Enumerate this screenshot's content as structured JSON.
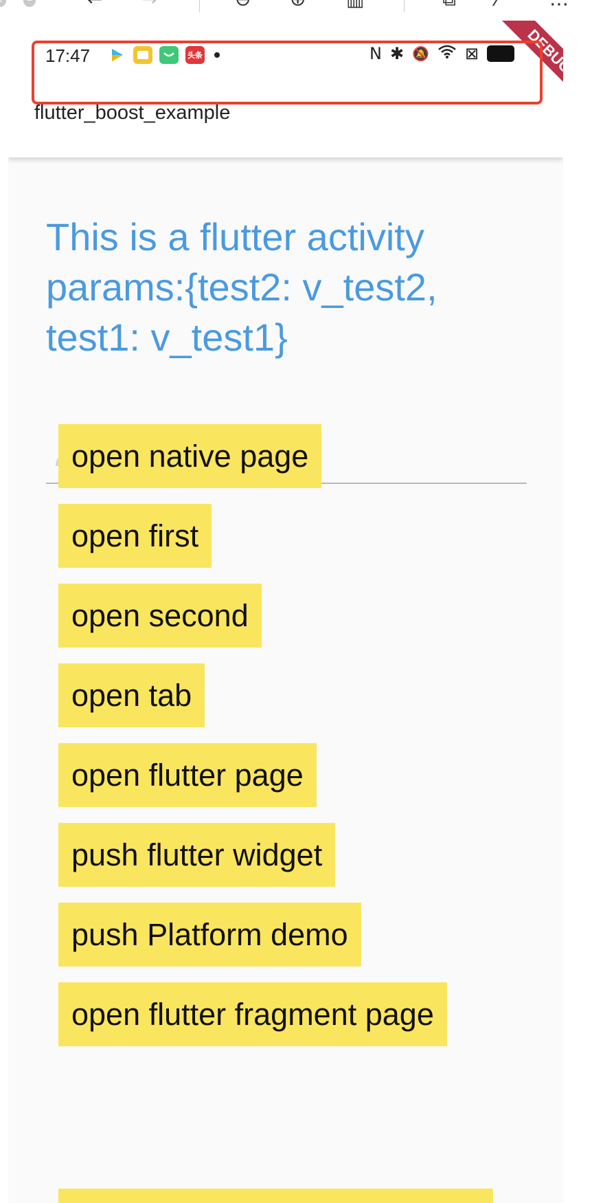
{
  "viewer_toolbar": {
    "icons": [
      "close-icon",
      "back-icon",
      "forward-icon",
      "zoom-out-icon",
      "zoom-in-icon",
      "fit-page-icon",
      "rotate-icon",
      "magic-wand-icon",
      "more-icon"
    ]
  },
  "status_bar": {
    "time": "17:47",
    "apps": [
      {
        "icon": "video-app-icon",
        "color": "#37b6ea"
      },
      {
        "icon": "notes-app-icon",
        "color": "#f4c430"
      },
      {
        "icon": "wechat-store-icon",
        "color": "#3fc77a",
        "text": ""
      },
      {
        "icon": "toutiao-app-icon",
        "color": "#e0373a",
        "text": "头条"
      }
    ],
    "right_icons": [
      "nfc-icon",
      "bluetooth-icon",
      "mute-icon",
      "wifi-icon",
      "sim-icon",
      "battery-icon"
    ],
    "right_glyphs": [
      "N",
      "✱",
      "🔕",
      "≋",
      "⊠"
    ]
  },
  "app_bar": {
    "title": "flutter_boost_example"
  },
  "debug_banner": {
    "label": "DEBUG",
    "color": "#b0102a"
  },
  "highlight_color": "#e8412f",
  "headline": "This is a flutter activity\n params:{test2: v_test2, test1: v_test1}",
  "name_field": {
    "placeholder": "Name",
    "value": ""
  },
  "buttons": [
    "open native page",
    "open first",
    "open second",
    "open tab",
    "open flutter page",
    "push flutter widget",
    "push Platform demo",
    "open flutter fragment page",
    ""
  ],
  "colors": {
    "button_bg": "#fae55f",
    "headline": "#4a9ae0",
    "background": "#fafafa"
  }
}
